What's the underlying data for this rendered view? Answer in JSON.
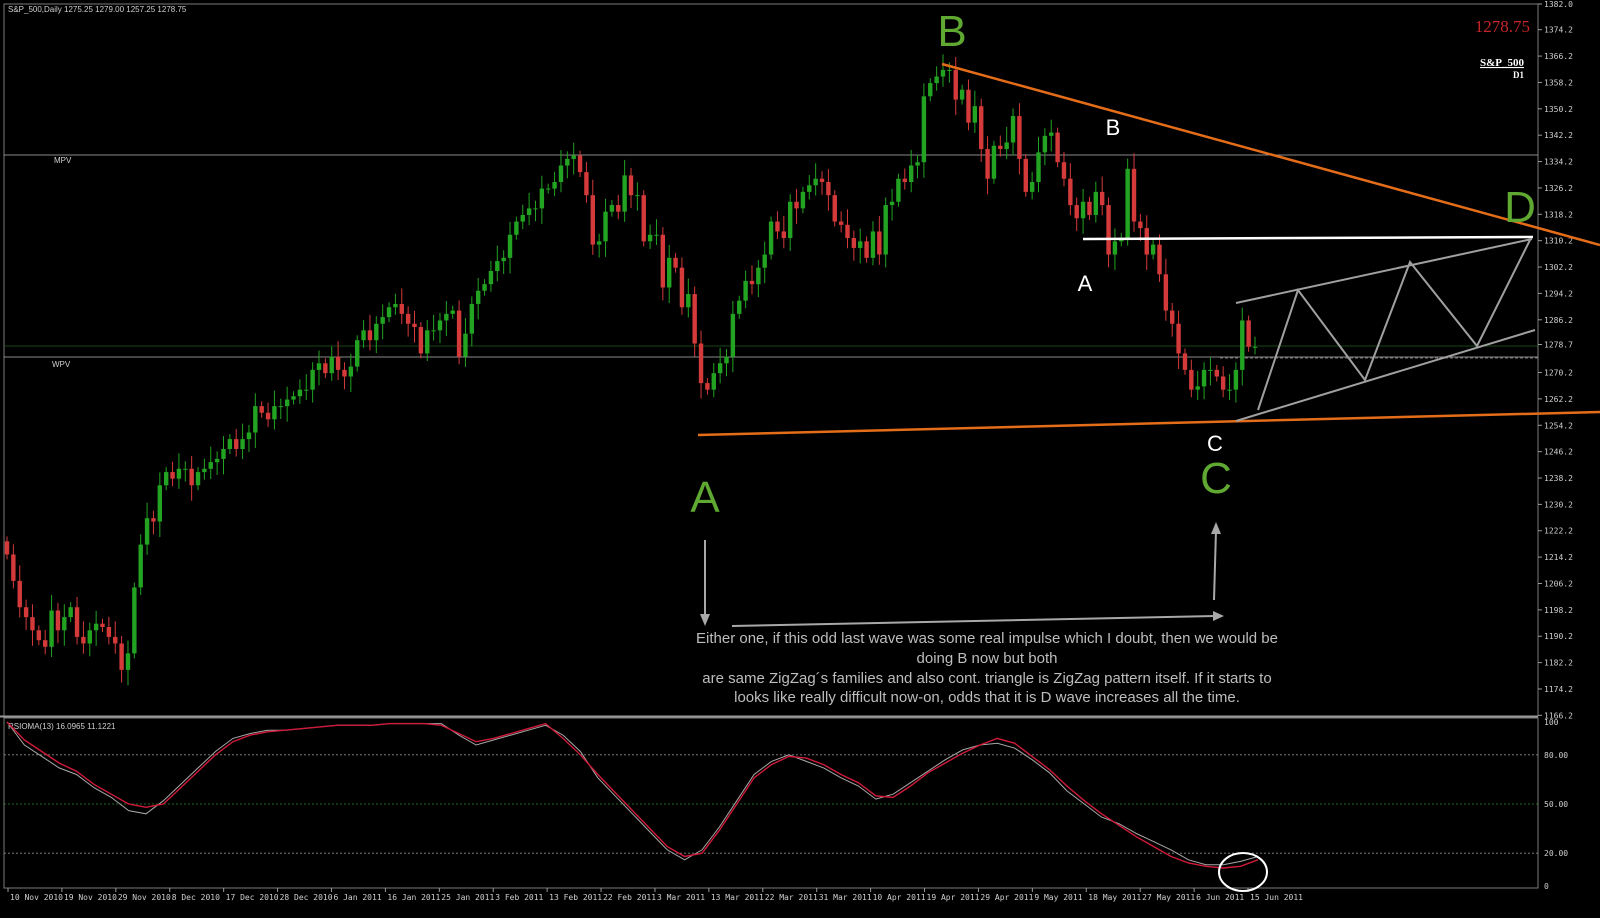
{
  "header": {
    "symbol_tf": "S&P_500,Daily",
    "ohlc": "1275.25 1279.00 1257.25 1278.75"
  },
  "top_right": {
    "last_price": "1278.75",
    "symbol": "S&P_500",
    "timeframe": "D1"
  },
  "level_labels": {
    "mpv": "MPV",
    "wpv": "WPV"
  },
  "annotations": {
    "big_a": "A",
    "big_b": "B",
    "big_c": "C",
    "big_d": "D",
    "small_a": "A",
    "small_b": "B",
    "small_c": "C"
  },
  "note_lines": [
    "Either one, if this odd last wave was some real impulse which I doubt, then we would be",
    "doing B now but both",
    "are same ZigZag´s families and also cont. triangle is ZigZag pattern itself. If it starts to",
    "looks like really difficult now-on, odds that it is D wave increases all the time."
  ],
  "indicator": {
    "label": "RSIOMA(13) 16.0965 11.1221"
  },
  "colors": {
    "background": "#000000",
    "bull": "#22a322",
    "bear": "#d43a3a",
    "orange": "#e46d19",
    "green_label": "#5fa832",
    "rsi_main": "#d01a3a",
    "rsi_signal": "#a8a8a8",
    "price_red": "#c6262b"
  },
  "chart_data": [
    {
      "type": "candlestick",
      "title": "S&P_500,Daily",
      "ylim": [
        1166,
        1382
      ],
      "y_ticks": [
        1382.0,
        1374.2,
        1366.2,
        1358.2,
        1350.2,
        1342.2,
        1334.2,
        1326.2,
        1318.2,
        1310.2,
        1302.2,
        1294.2,
        1286.2,
        1278.7,
        1270.2,
        1262.2,
        1254.2,
        1246.2,
        1238.2,
        1230.2,
        1222.2,
        1214.2,
        1206.2,
        1198.2,
        1190.2,
        1182.2,
        1174.2,
        1166.2
      ],
      "x_tick_labels": [
        "10 Nov 2010",
        "19 Nov 2010",
        "29 Nov 2010",
        "8 Dec 2010",
        "17 Dec 2010",
        "28 Dec 2010",
        "6 Jan 2011",
        "16 Jan 2011",
        "25 Jan 2011",
        "3 Feb 2011",
        "13 Feb 2011",
        "22 Feb 2011",
        "3 Mar 2011",
        "13 Mar 2011",
        "22 Mar 2011",
        "31 Mar 2011",
        "10 Apr 2011",
        "19 Apr 2011",
        "29 Apr 2011",
        "9 May 2011",
        "18 May 2011",
        "27 May 2011",
        "6 Jun 2011",
        "15 Jun 2011"
      ],
      "horizontal_levels": [
        {
          "name": "MPV",
          "value": 1337.5
        },
        {
          "name": "WPV",
          "value": 1275.5
        },
        {
          "name": "current",
          "value": 1278.75
        }
      ],
      "closes": [
        1215,
        1207,
        1199,
        1196,
        1192,
        1189,
        1187,
        1198,
        1192,
        1196,
        1199,
        1190,
        1188,
        1192,
        1194,
        1193,
        1190,
        1188,
        1180,
        1185,
        1205,
        1218,
        1226,
        1225,
        1236,
        1240,
        1238,
        1241,
        1241,
        1236,
        1240,
        1241,
        1243,
        1244,
        1247,
        1250,
        1247,
        1250,
        1252,
        1260,
        1258,
        1256,
        1260,
        1260,
        1262,
        1263,
        1265,
        1265,
        1271,
        1273,
        1270,
        1275,
        1271,
        1269,
        1272,
        1280,
        1283,
        1280,
        1285,
        1287,
        1290,
        1291,
        1288,
        1285,
        1284,
        1276,
        1283,
        1283,
        1286,
        1288,
        1289,
        1275,
        1282,
        1291,
        1295,
        1297,
        1301,
        1304,
        1305,
        1312,
        1316,
        1318,
        1320,
        1320,
        1326,
        1326,
        1328,
        1333,
        1335,
        1336,
        1331,
        1324,
        1309,
        1310,
        1319,
        1321,
        1319,
        1330,
        1324,
        1324,
        1310,
        1312,
        1312,
        1296,
        1305,
        1302,
        1290,
        1294,
        1279,
        1267,
        1265,
        1270,
        1273,
        1275,
        1288,
        1292,
        1298,
        1297,
        1302,
        1306,
        1316,
        1313,
        1311,
        1322,
        1320,
        1325,
        1327,
        1329,
        1328,
        1324,
        1316,
        1315,
        1311,
        1308,
        1310,
        1305,
        1313,
        1306,
        1321,
        1322,
        1329,
        1328,
        1333,
        1334,
        1354,
        1358,
        1360,
        1362,
        1362,
        1353,
        1356,
        1346,
        1351,
        1338,
        1329,
        1339,
        1338,
        1340,
        1348,
        1335,
        1325,
        1328,
        1337,
        1342,
        1343,
        1334,
        1329,
        1321,
        1317,
        1322,
        1318,
        1325,
        1321,
        1306,
        1310,
        1311,
        1332,
        1316,
        1314,
        1306,
        1309,
        1300,
        1289,
        1285,
        1276,
        1271,
        1265,
        1266,
        1271,
        1271,
        1269,
        1265,
        1265,
        1271,
        1286,
        1278,
        1278
      ]
    },
    {
      "type": "line",
      "title": "RSIOMA(13) 16.0965 11.1221",
      "ylim": [
        0,
        100
      ],
      "y_ticks": [
        100,
        80,
        50,
        20,
        0
      ],
      "levels": [
        80,
        50,
        20
      ],
      "series": [
        {
          "name": "RSIOMA",
          "values": [
            100,
            89,
            82,
            75,
            70,
            62,
            56,
            50,
            48,
            50,
            60,
            70,
            80,
            88,
            92,
            94,
            95,
            96,
            97,
            98,
            98,
            98,
            99,
            99,
            99,
            98,
            93,
            88,
            90,
            93,
            96,
            99,
            90,
            80,
            68,
            57,
            46,
            35,
            24,
            18,
            20,
            34,
            50,
            66,
            74,
            79,
            78,
            74,
            68,
            63,
            55,
            54,
            61,
            69,
            75,
            81,
            86,
            90,
            87,
            79,
            71,
            61,
            52,
            44,
            37,
            30,
            24,
            18,
            14,
            12,
            11,
            12,
            16
          ]
        },
        {
          "name": "signal",
          "values": [
            100,
            86,
            79,
            72,
            68,
            60,
            54,
            46,
            44,
            52,
            62,
            72,
            82,
            90,
            93,
            95,
            95,
            96,
            97,
            98,
            98,
            98,
            99,
            99,
            99,
            99,
            92,
            86,
            89,
            92,
            95,
            98,
            92,
            82,
            66,
            55,
            44,
            33,
            22,
            16,
            22,
            36,
            52,
            68,
            76,
            80,
            76,
            72,
            66,
            61,
            53,
            56,
            63,
            70,
            77,
            83,
            86,
            87,
            84,
            77,
            69,
            58,
            50,
            42,
            38,
            32,
            27,
            22,
            16,
            13,
            13,
            15,
            18
          ]
        }
      ]
    }
  ]
}
